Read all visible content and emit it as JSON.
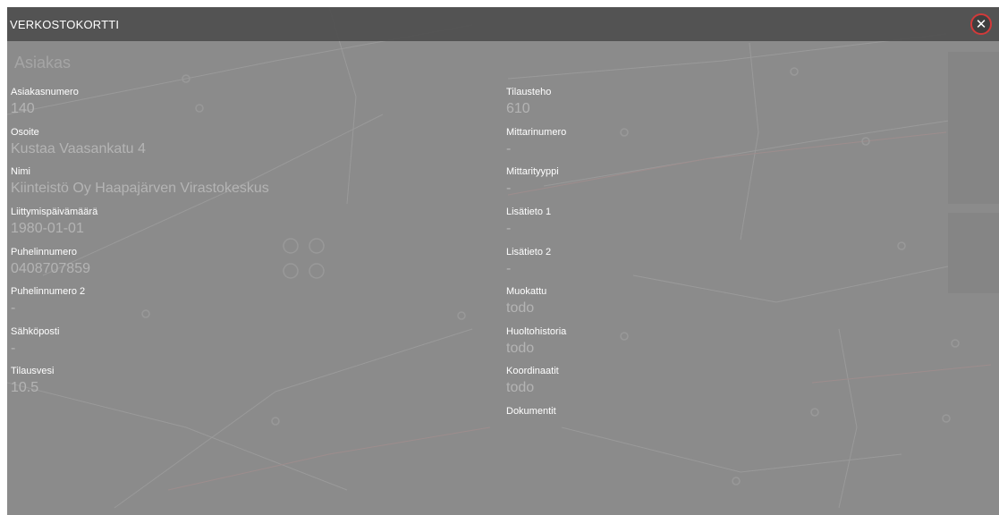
{
  "window": {
    "title": "VERKOSTOKORTTI",
    "close_label": "✕"
  },
  "section": {
    "title": "Asiakas"
  },
  "left_fields": [
    {
      "label": "Asiakasnumero",
      "value": "140"
    },
    {
      "label": "Osoite",
      "value": "Kustaa Vaasankatu 4"
    },
    {
      "label": "Nimi",
      "value": "Kiinteistö Oy Haapajärven Virastokeskus"
    },
    {
      "label": "Liittymispäivämäärä",
      "value": "1980-01-01"
    },
    {
      "label": "Puhelinnumero",
      "value": "0408707859"
    },
    {
      "label": "Puhelinnumero 2",
      "value": "-"
    },
    {
      "label": "Sähköposti",
      "value": "-"
    },
    {
      "label": "Tilausvesi",
      "value": "10.5"
    }
  ],
  "right_fields": [
    {
      "label": "Tilausteho",
      "value": "610"
    },
    {
      "label": "Mittarinumero",
      "value": "-"
    },
    {
      "label": "Mittarityyppi",
      "value": "-"
    },
    {
      "label": "Lisätieto 1",
      "value": "-"
    },
    {
      "label": "Lisätieto 2",
      "value": "-"
    },
    {
      "label": "Muokattu",
      "value": "todo"
    },
    {
      "label": "Huoltohistoria",
      "value": "todo"
    },
    {
      "label": "Koordinaatit",
      "value": "todo"
    },
    {
      "label": "Dokumentit",
      "value": ""
    }
  ],
  "colors": {
    "overlay": "#8a8a8a",
    "titlebar": "#4e4e4e",
    "close_ring": "#d23a3a",
    "label": "#ffffff",
    "value": "#b4b4b4"
  }
}
